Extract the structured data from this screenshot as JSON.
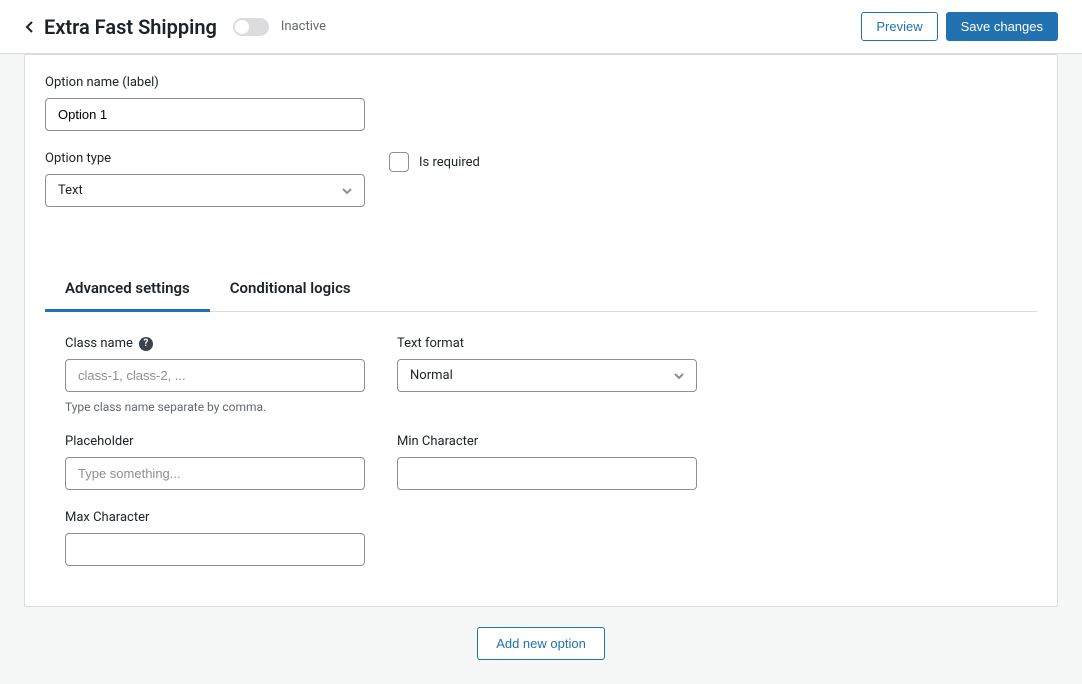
{
  "header": {
    "title": "Extra Fast Shipping",
    "status": "Inactive",
    "preview_label": "Preview",
    "save_label": "Save changes"
  },
  "option": {
    "name_label": "Option name (label)",
    "name_value": "Option 1",
    "required_label": "Is required",
    "type_label": "Option type",
    "type_value": "Text"
  },
  "tabs": {
    "advanced": "Advanced settings",
    "conditional": "Conditional logics"
  },
  "advanced": {
    "class_name_label": "Class name",
    "class_name_placeholder": "class-1, class-2, ...",
    "class_name_help": "Type class name separate by comma.",
    "text_format_label": "Text format",
    "text_format_value": "Normal",
    "placeholder_label": "Placeholder",
    "placeholder_placeholder": "Type something...",
    "min_char_label": "Min Character",
    "max_char_label": "Max Character"
  },
  "footer": {
    "add_option_label": "Add new option"
  }
}
